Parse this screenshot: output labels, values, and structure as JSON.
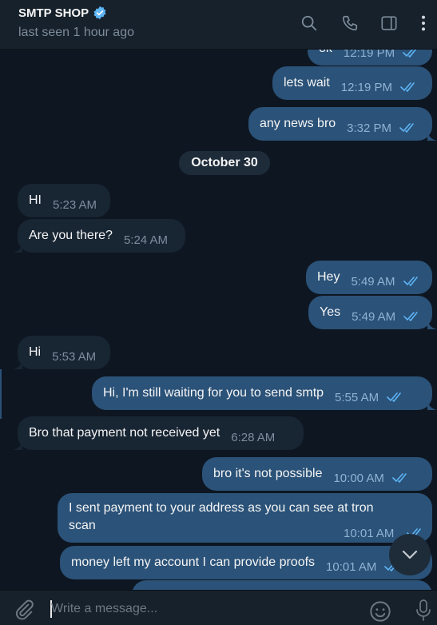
{
  "header": {
    "title": "SMTP SHOP",
    "status": "last seen 1 hour ago"
  },
  "messages": [
    {
      "dir": "out",
      "text": "ok",
      "time": "12:19 PM"
    },
    {
      "dir": "out",
      "text": "lets wait",
      "time": "12:19 PM"
    },
    {
      "dir": "out",
      "text": "any news bro",
      "time": "3:32 PM"
    },
    {
      "dir": "in",
      "text": "HI",
      "time": "5:23 AM"
    },
    {
      "dir": "in",
      "text": "Are you there?",
      "time": "5:24 AM"
    },
    {
      "dir": "out",
      "text": "Hey",
      "time": "5:49 AM"
    },
    {
      "dir": "out",
      "text": "Yes",
      "time": "5:49 AM"
    },
    {
      "dir": "in",
      "text": "Hi",
      "time": "5:53 AM"
    },
    {
      "dir": "out",
      "text": "Hi, I'm still waiting for you to send smtp",
      "time": "5:55 AM"
    },
    {
      "dir": "in",
      "text": "Bro that payment not received yet",
      "time": "6:28 AM"
    },
    {
      "dir": "out",
      "text": "bro it's not possible",
      "time": "10:00 AM"
    },
    {
      "dir": "out",
      "text": "I sent payment to your address as you can see at tron scan",
      "time": "10:01 AM"
    },
    {
      "dir": "out",
      "text": "money left my account I can provide proofs",
      "time": "10:01 AM"
    }
  ],
  "date_separator": "October 30",
  "composer": {
    "placeholder": "Write a message..."
  },
  "icons": {
    "header": [
      "search-icon",
      "phone-icon",
      "sidebar-toggle-icon",
      "more-vert-icon"
    ],
    "composer": [
      "attach-icon",
      "emoji-icon",
      "microphone-icon"
    ],
    "scroll": "chevron-down-icon"
  },
  "colors": {
    "bg": "#0e1621",
    "header": "#17212b",
    "incoming": "#182533",
    "outgoing": "#2b5278",
    "accent": "#5eb5f7"
  }
}
